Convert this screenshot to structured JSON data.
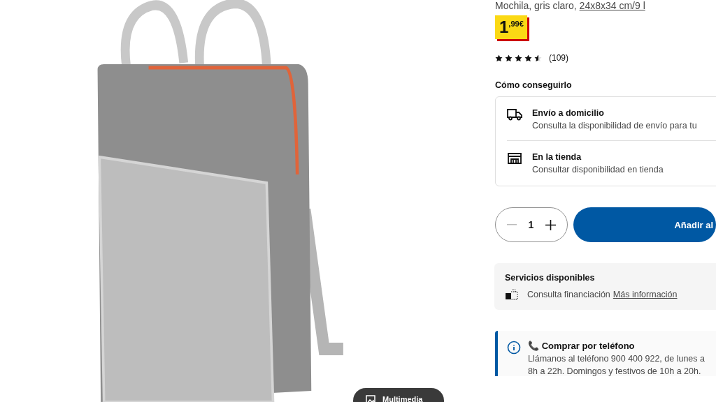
{
  "product": {
    "description": "Mochila, gris claro,",
    "size_link": "24x8x34 cm/9 l",
    "price_whole": "1",
    "price_decimal": ",99€",
    "stars": 4.5,
    "reviews": "(109)"
  },
  "media_button": {
    "label": "Multimedia"
  },
  "delivery": {
    "heading": "Cómo conseguirlo",
    "options": [
      {
        "kind": "home",
        "title": "Envío a domicilio",
        "text": "Consulta la disponibilidad de envío para tu"
      },
      {
        "kind": "store",
        "title": "En la tienda",
        "text": "Consultar disponibilidad en tienda"
      }
    ]
  },
  "quantity": {
    "value": "1",
    "add_label": "Añadir al"
  },
  "services": {
    "title": "Servicios disponibles",
    "text": "Consulta financiación",
    "link": "Más información"
  },
  "phone": {
    "icon": "📞",
    "title": "Comprar por teléfono",
    "lines": [
      "Llámanos al teléfono 900 400 922, de lunes a",
      "8h a 22h. Domingos y festivos de 10h a 20h."
    ]
  }
}
